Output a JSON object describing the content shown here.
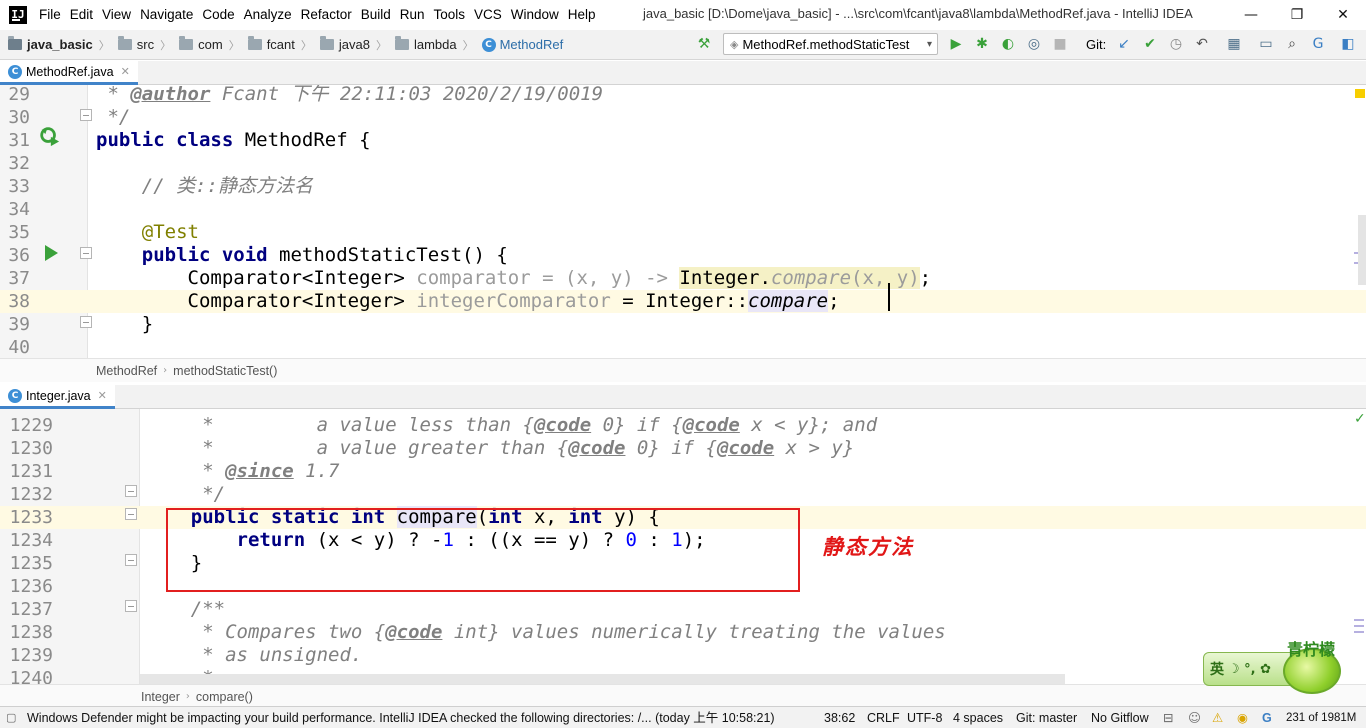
{
  "app": {
    "logo_text": "IJ",
    "window_title": "java_basic [D:\\Dome\\java_basic] - ...\\src\\com\\fcant\\java8\\lambda\\MethodRef.java - IntelliJ IDEA"
  },
  "menu": [
    "File",
    "Edit",
    "View",
    "Navigate",
    "Code",
    "Analyze",
    "Refactor",
    "Build",
    "Run",
    "Tools",
    "VCS",
    "Window",
    "Help"
  ],
  "window_controls": {
    "minimize": "—",
    "maximize": "❐",
    "close": "✕"
  },
  "navbar": {
    "crumbs": [
      "java_basic",
      "src",
      "com",
      "fcant",
      "java8",
      "lambda",
      "MethodRef"
    ],
    "run_config": "MethodRef.methodStaticTest",
    "git_label": "Git:"
  },
  "top_editor": {
    "tab_label": "MethodRef.java",
    "lines": [
      {
        "n": "29",
        "parts": [
          [
            "cm",
            " * "
          ],
          [
            "tag",
            "@author"
          ],
          [
            "cm",
            " Fcant 下午 22:11:03 2020/2/19/0019"
          ]
        ]
      },
      {
        "n": "30",
        "parts": [
          [
            "cm",
            " */"
          ]
        ]
      },
      {
        "n": "31",
        "parts": [
          [
            "kw",
            "public class "
          ],
          [
            "",
            "MethodRef {"
          ]
        ]
      },
      {
        "n": "32",
        "parts": []
      },
      {
        "n": "33",
        "parts": [
          [
            "cm",
            "    // 类::静态方法名"
          ]
        ]
      },
      {
        "n": "34",
        "parts": []
      },
      {
        "n": "35",
        "parts": [
          [
            "ann",
            "    @Test"
          ]
        ]
      },
      {
        "n": "36",
        "parts": [
          [
            "kw",
            "    public void "
          ],
          [
            "",
            "methodStaticTest() {"
          ]
        ]
      },
      {
        "n": "37",
        "parts": [
          [
            "",
            "        Comparator<Integer> "
          ],
          [
            "grey",
            "comparator"
          ],
          [
            "",
            " "
          ],
          [
            "grey",
            "= (x, y) -> "
          ],
          [
            "hl-lambda",
            "Integer."
          ],
          [
            "hl-lambda grey-italic",
            "compare"
          ],
          [
            "hl-lambda grey",
            "(x, y)"
          ],
          [
            "",
            ";"
          ]
        ]
      },
      {
        "n": "38",
        "parts": [
          [
            "",
            "        Comparator<Integer> "
          ],
          [
            "grey",
            "integerComparator"
          ],
          [
            "",
            " = Integer::"
          ],
          [
            "hl-usage sm",
            "compare"
          ],
          [
            "",
            ";"
          ]
        ]
      },
      {
        "n": "39",
        "parts": [
          [
            "",
            "    }"
          ]
        ]
      },
      {
        "n": "40",
        "parts": []
      }
    ],
    "breadcrumbs": [
      "MethodRef",
      "methodStaticTest()"
    ]
  },
  "bottom_editor": {
    "tab_label": "Integer.java",
    "lines": [
      {
        "n": "1229",
        "parts": [
          [
            "cm",
            "     *         a value less than {"
          ],
          [
            "tag",
            "@code"
          ],
          [
            "cm",
            " 0} if {"
          ],
          [
            "tag",
            "@code"
          ],
          [
            "cm",
            " x < y}; and"
          ]
        ]
      },
      {
        "n": "1230",
        "parts": [
          [
            "cm",
            "     *         a value greater than {"
          ],
          [
            "tag",
            "@code"
          ],
          [
            "cm",
            " 0} if {"
          ],
          [
            "tag",
            "@code"
          ],
          [
            "cm",
            " x > y}"
          ]
        ]
      },
      {
        "n": "1231",
        "parts": [
          [
            "cm",
            "     * "
          ],
          [
            "tag",
            "@since"
          ],
          [
            "cm",
            " 1.7"
          ]
        ]
      },
      {
        "n": "1232",
        "parts": [
          [
            "cm",
            "     */"
          ]
        ]
      },
      {
        "n": "1233",
        "parts": [
          [
            "kw",
            "    public static int "
          ],
          [
            "hl-usage",
            "compare"
          ],
          [
            "",
            "("
          ],
          [
            "kw",
            "int "
          ],
          [
            "",
            "x, "
          ],
          [
            "kw",
            "int "
          ],
          [
            "",
            "y) {"
          ]
        ]
      },
      {
        "n": "1234",
        "parts": [
          [
            "kw",
            "        return "
          ],
          [
            "",
            "(x < y) ? -"
          ],
          [
            "num",
            "1"
          ],
          [
            "",
            " : ((x == y) ? "
          ],
          [
            "num",
            "0"
          ],
          [
            "",
            " : "
          ],
          [
            "num",
            "1"
          ],
          [
            "",
            ");"
          ]
        ]
      },
      {
        "n": "1235",
        "parts": [
          [
            "",
            "    }"
          ]
        ]
      },
      {
        "n": "1236",
        "parts": []
      },
      {
        "n": "1237",
        "parts": [
          [
            "cm",
            "    /**"
          ]
        ]
      },
      {
        "n": "1238",
        "parts": [
          [
            "cm",
            "     * Compares two {"
          ],
          [
            "tag",
            "@code"
          ],
          [
            "cm",
            " int} values numerically treating the values"
          ]
        ]
      },
      {
        "n": "1239",
        "parts": [
          [
            "cm",
            "     * as unsigned."
          ]
        ]
      },
      {
        "n": "1240",
        "parts": [
          [
            "cm",
            "     *"
          ]
        ]
      }
    ],
    "breadcrumbs": [
      "Integer",
      "compare()"
    ]
  },
  "annotation": {
    "label": "静态方法",
    "color": "#e21f1f"
  },
  "ime": {
    "mode": "英",
    "symbols": "☽ °, ✿",
    "brand": "青柠檬"
  },
  "statusbar": {
    "message": "Windows Defender might be impacting your build performance. IntelliJ IDEA checked the following directories: /... (today 上午 10:58:21)",
    "position": "38:62",
    "line_sep": "CRLF",
    "encoding": "UTF-8",
    "indent": "4 spaces",
    "git_branch": "Git: master",
    "gitflow": "No Gitflow",
    "memory": "231 of 1981M"
  },
  "colors": {
    "accent": "#4083c9",
    "run_green": "#3aa13a",
    "current_line": "#fffae3"
  }
}
